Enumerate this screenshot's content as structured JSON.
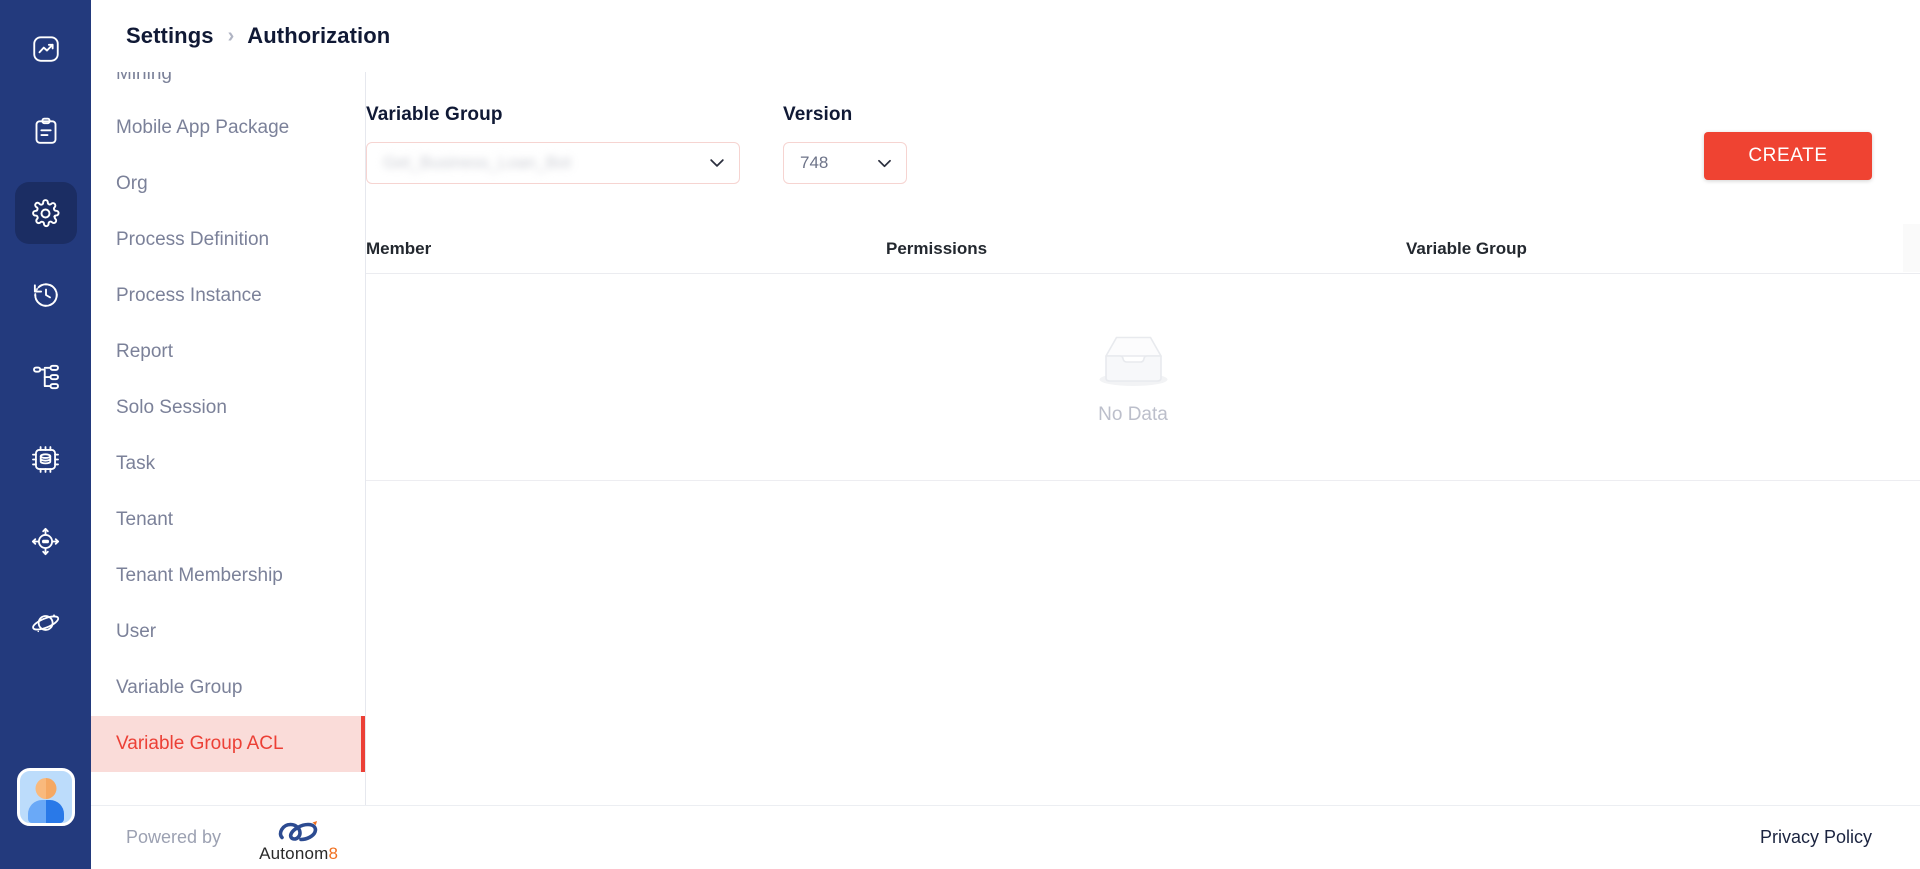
{
  "rail": {
    "items": [
      {
        "name": "analytics-icon",
        "label": "Analytics",
        "active": false
      },
      {
        "name": "clipboard-icon",
        "label": "Tasks",
        "active": false
      },
      {
        "name": "gear-icon",
        "label": "Settings",
        "active": true
      },
      {
        "name": "history-icon",
        "label": "History",
        "active": false
      },
      {
        "name": "sitemap-icon",
        "label": "Process Tree",
        "active": false
      },
      {
        "name": "chip-icon",
        "label": "Data Processing",
        "active": false
      },
      {
        "name": "target-icon",
        "label": "Monitoring",
        "active": false
      },
      {
        "name": "planet-icon",
        "label": "Universe",
        "active": false
      }
    ],
    "avatar_label": "User Profile"
  },
  "breadcrumb": {
    "root": "Settings",
    "separator": "›",
    "current": "Authorization"
  },
  "settings_menu": {
    "items": [
      {
        "label": "Mining",
        "active": false,
        "clipped": true
      },
      {
        "label": "Mobile App Package",
        "active": false,
        "clipped": false
      },
      {
        "label": "Org",
        "active": false,
        "clipped": false
      },
      {
        "label": "Process Definition",
        "active": false,
        "clipped": false
      },
      {
        "label": "Process Instance",
        "active": false,
        "clipped": false
      },
      {
        "label": "Report",
        "active": false,
        "clipped": false
      },
      {
        "label": "Solo Session",
        "active": false,
        "clipped": false
      },
      {
        "label": "Task",
        "active": false,
        "clipped": false
      },
      {
        "label": "Tenant",
        "active": false,
        "clipped": false
      },
      {
        "label": "Tenant Membership",
        "active": false,
        "clipped": false
      },
      {
        "label": "User",
        "active": false,
        "clipped": false
      },
      {
        "label": "Variable Group",
        "active": false,
        "clipped": false
      },
      {
        "label": "Variable Group ACL",
        "active": true,
        "clipped": false
      }
    ]
  },
  "controls": {
    "variable_group": {
      "label": "Variable Group",
      "value": "Get_Business_Loan_Bot",
      "redacted": true
    },
    "version": {
      "label": "Version",
      "value": "748"
    },
    "create_button": "CREATE"
  },
  "table": {
    "columns": [
      "Member",
      "Permissions",
      "Variable Group"
    ],
    "rows": [],
    "empty_text": "No Data"
  },
  "footer": {
    "powered_by": "Powered by",
    "brand_name": "Autonom",
    "brand_suffix": "8",
    "privacy_policy": "Privacy Policy"
  },
  "colors": {
    "rail_background": "#233a7d",
    "rail_active": "#1b2d63",
    "accent_red": "#ef4332",
    "active_menu_bg": "#fadcd9",
    "menu_text": "#7b8199",
    "heading_text": "#101935",
    "brand_orange": "#f07020"
  }
}
